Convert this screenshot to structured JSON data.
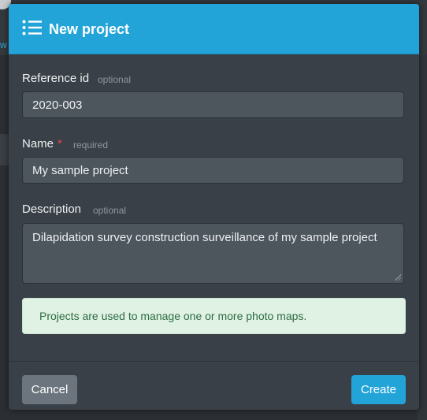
{
  "dialog": {
    "title": "New project",
    "title_icon": "list-icon"
  },
  "fields": {
    "reference": {
      "label": "Reference id",
      "hint": "optional",
      "value": "2020-003"
    },
    "name": {
      "label": "Name",
      "required_mark": "*",
      "hint": "required",
      "value": "My sample project"
    },
    "description": {
      "label": "Description",
      "hint": "optional",
      "value": "Dilapidation survey construction surveillance of my sample project"
    }
  },
  "info": {
    "text": "Projects are used to manage one or more photo maps."
  },
  "buttons": {
    "cancel": "Cancel",
    "create": "Create"
  },
  "colors": {
    "header": "#22a4d8",
    "modal_bg": "#3a4047",
    "input_bg": "#4d555d",
    "info_bg": "#dff2e4",
    "info_text": "#2f6b43",
    "cancel_bg": "#6c757d",
    "create_bg": "#22a4d8",
    "required": "#e0464a"
  }
}
